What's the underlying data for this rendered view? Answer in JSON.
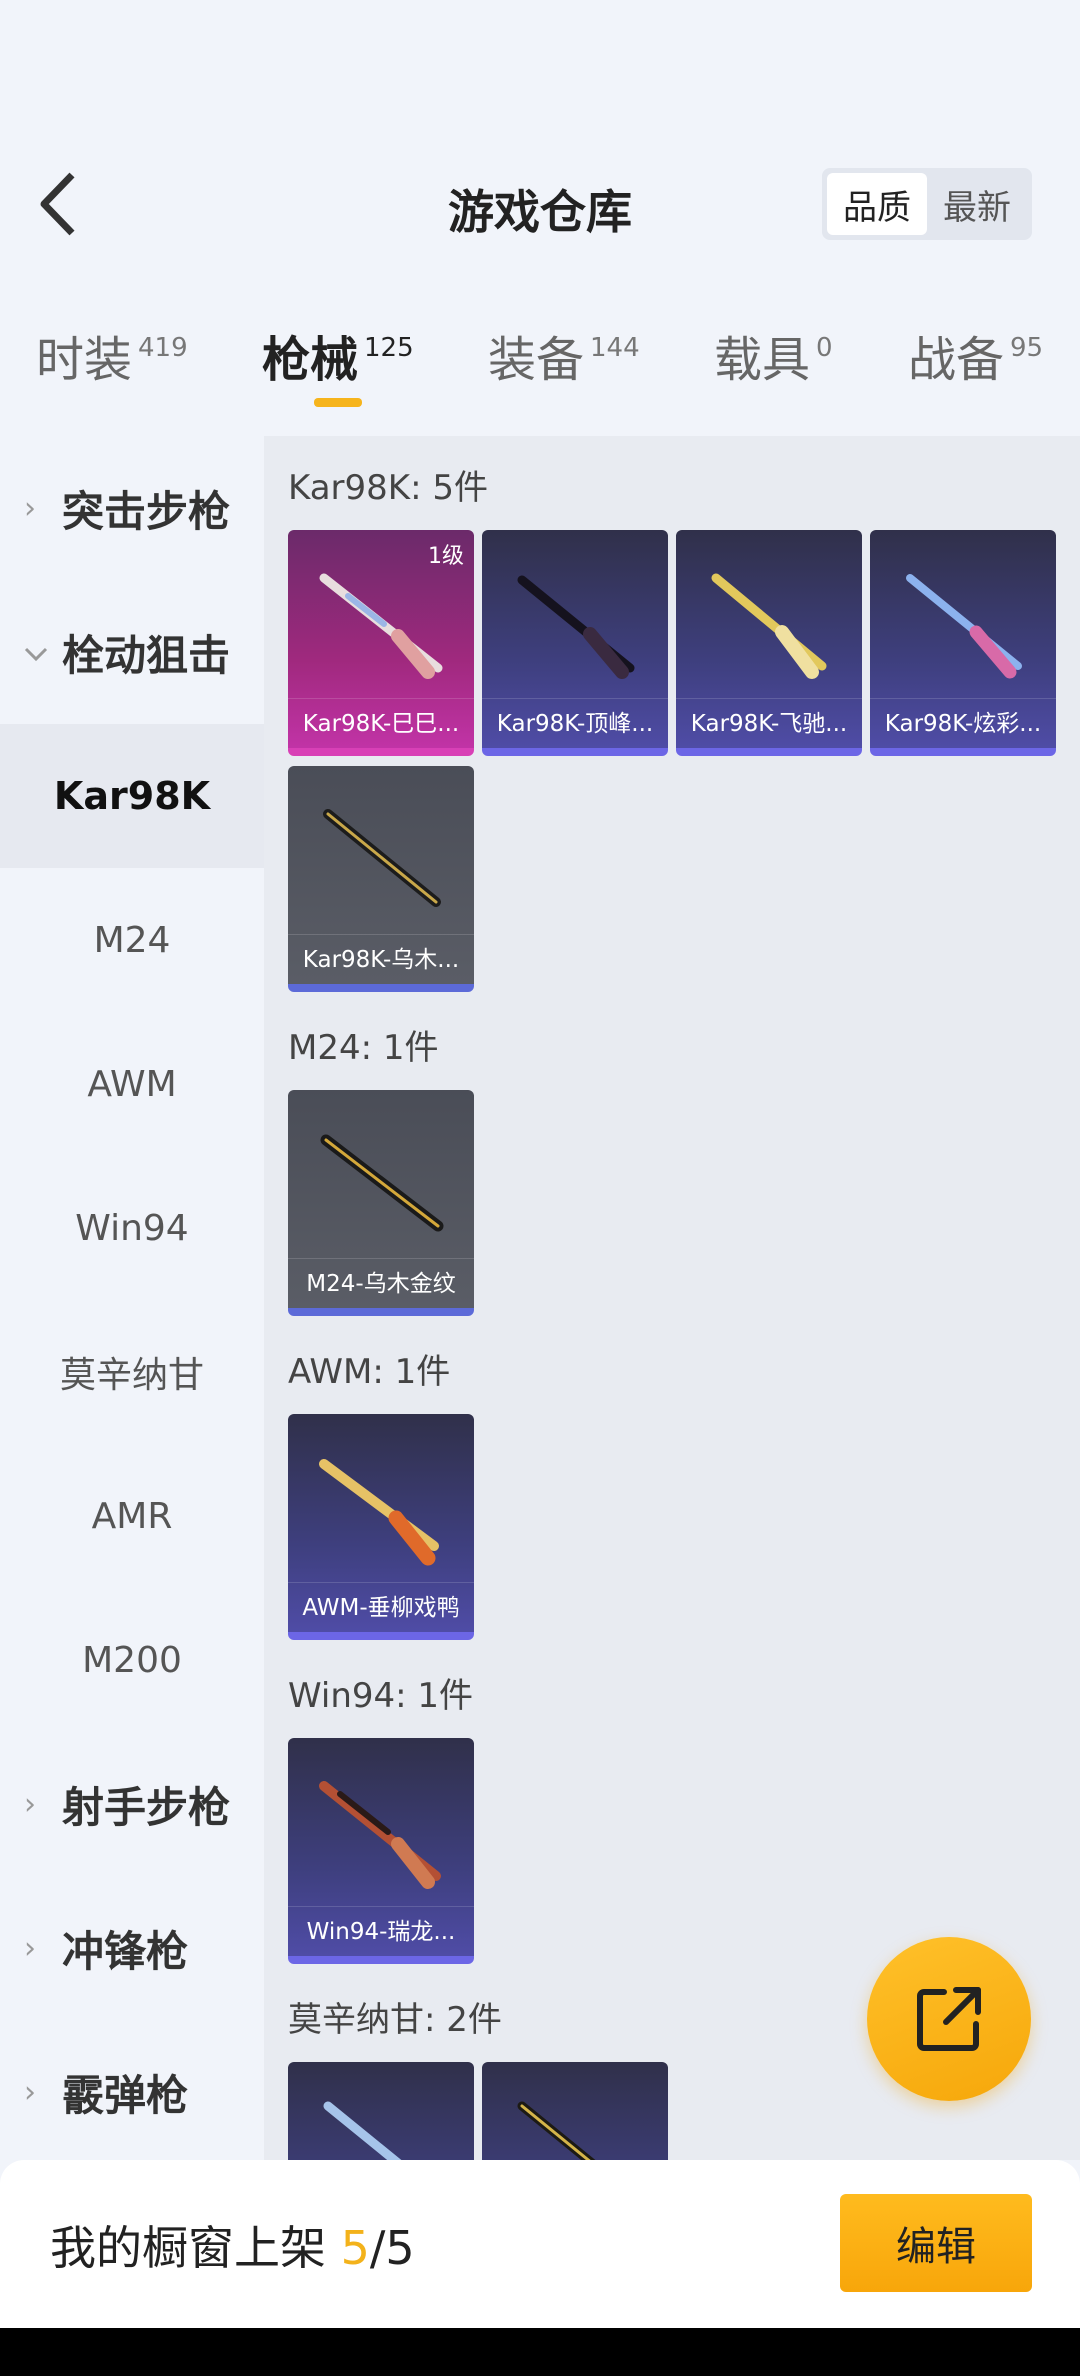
{
  "header": {
    "title": "游戏仓库",
    "sort": {
      "quality": "品质",
      "latest": "最新"
    }
  },
  "tabs": [
    {
      "label": "时装",
      "count": "419"
    },
    {
      "label": "枪械",
      "count": "125"
    },
    {
      "label": "装备",
      "count": "144"
    },
    {
      "label": "载具",
      "count": "0"
    },
    {
      "label": "战备",
      "count": "95"
    }
  ],
  "sidebar": {
    "assault": "突击步枪",
    "bolt": "栓动狙击",
    "kar98k": "Kar98K",
    "m24": "M24",
    "awm": "AWM",
    "win94": "Win94",
    "mosin": "莫辛纳甘",
    "amr": "AMR",
    "m200": "M200",
    "dmr": "射手步枪",
    "smg": "冲锋枪",
    "shotgun": "霰弹枪"
  },
  "sections": {
    "kar98k": {
      "title": "Kar98K: 5件",
      "items": [
        {
          "name": "Kar98K-巳巳...",
          "level": "1级"
        },
        {
          "name": "Kar98K-顶峰..."
        },
        {
          "name": "Kar98K-飞驰..."
        },
        {
          "name": "Kar98K-炫彩..."
        },
        {
          "name": "Kar98K-乌木..."
        }
      ]
    },
    "m24": {
      "title": "M24: 1件",
      "items": [
        {
          "name": "M24-乌木金纹"
        }
      ]
    },
    "awm": {
      "title": "AWM: 1件",
      "items": [
        {
          "name": "AWM-垂柳戏鸭"
        }
      ]
    },
    "win94": {
      "title": "Win94: 1件",
      "items": [
        {
          "name": "Win94-瑞龙..."
        }
      ]
    },
    "mosin": {
      "title": "莫辛纳甘: 2件"
    }
  },
  "bottom": {
    "label": "我的橱窗上架",
    "current": "5",
    "total": "/5",
    "edit": "编辑"
  }
}
